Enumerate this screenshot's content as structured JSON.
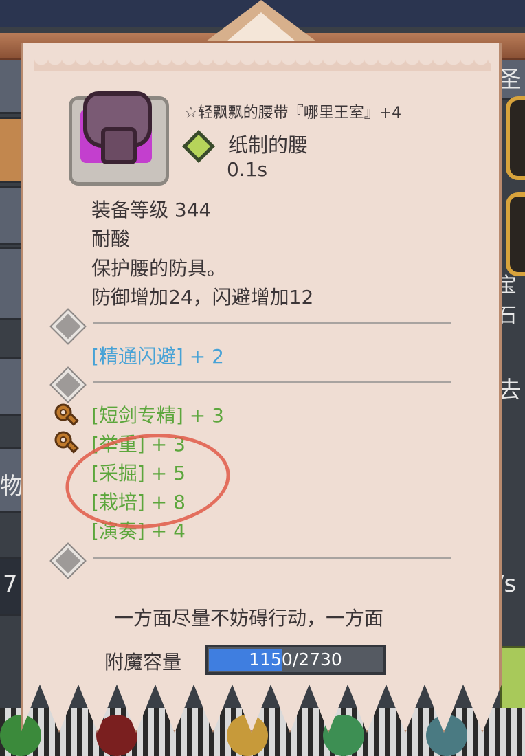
{
  "item": {
    "name": "☆轻飘飘的腰带『哪里王室』+4",
    "type": "纸制的腰",
    "speed": "0.1s",
    "level_line": "装备等级 344",
    "property": "耐酸",
    "description": "保护腰的防具。",
    "stats": "防御增加24，闪避增加12"
  },
  "skills_blue": [
    "[精通闪避] + 2"
  ],
  "skills_green": [
    "[短剑专精] + 3",
    "[举重] + 3",
    "[采掘] + 5",
    "[栽培] + 8",
    "[演奏] + 4"
  ],
  "flavor_text": "一方面尽量不妨碍行动，一方面",
  "enchant": {
    "label": "附魔容量",
    "value_text": "1150/2730",
    "current": 1150,
    "max": 2730
  },
  "background": {
    "left_texts": [
      "物"
    ],
    "right_texts": [
      "圣",
      "宝石",
      "去",
      "/s"
    ],
    "left_number": "7"
  },
  "colors": {
    "parchment": "#efddd3",
    "skill_blue": "#47a2d6",
    "skill_green": "#5ca63c",
    "bar_fill": "#3f7ee0",
    "annotation_red": "#e05a48"
  }
}
